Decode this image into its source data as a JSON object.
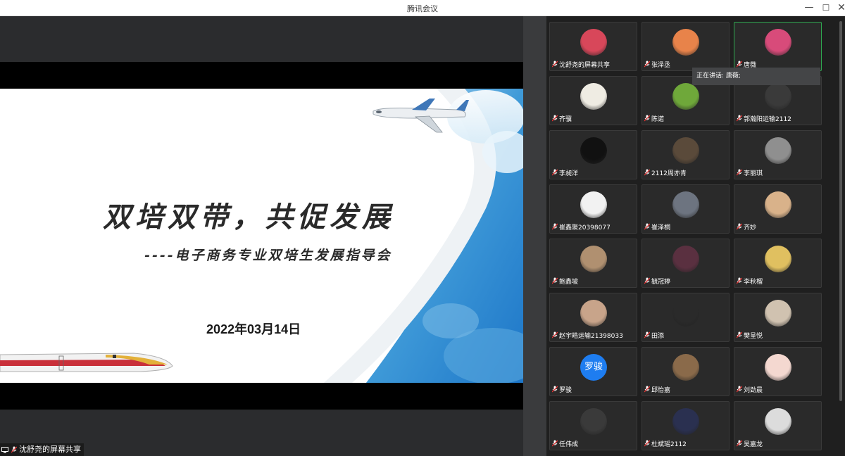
{
  "window": {
    "title": "腾讯会议",
    "min": "—",
    "max": "☐",
    "close": "✕"
  },
  "slide": {
    "title": "双培双带，共促发展",
    "subtitle": "----电子商务专业双培生发展指导会",
    "date": "2022年03月14日"
  },
  "share_label": "沈舒尧的屏幕共享",
  "speaking_tooltip": "正在讲话: 唐薇;",
  "participants": [
    {
      "name": "沈舒尧的屏幕共享",
      "avatar": "city-avatar",
      "color": "#d8475a"
    },
    {
      "name": "张泽丞",
      "avatar": "sunset-avatar",
      "color": "#e8834a"
    },
    {
      "name": "唐薇",
      "avatar": "anime-avatar",
      "color": "#d84b7a"
    },
    {
      "name": "齐骥",
      "avatar": "sketch-avatar",
      "color": "#efece3"
    },
    {
      "name": "陈诺",
      "avatar": "cartoon-avatar",
      "color": "#6fa83a"
    },
    {
      "name": "郭瀚阳运输2112",
      "avatar": "portrait-avatar",
      "color": "#3a3a3a"
    },
    {
      "name": "李昶洋",
      "avatar": "moon-avatar",
      "color": "#111111"
    },
    {
      "name": "2112周亦青",
      "avatar": "guitar-avatar",
      "color": "#5a4a3a"
    },
    {
      "name": "李丽琪",
      "avatar": "cat-avatar",
      "color": "#8f8f8f"
    },
    {
      "name": "崔鑫聚20398077",
      "avatar": "logo-avatar",
      "color": "#f2f2f2"
    },
    {
      "name": "崔泽桐",
      "avatar": "street-avatar",
      "color": "#6d7480"
    },
    {
      "name": "齐妙",
      "avatar": "dog-avatar",
      "color": "#d9b28a"
    },
    {
      "name": "鲍鑫坡",
      "avatar": "kitten-avatar",
      "color": "#b09070"
    },
    {
      "name": "毓冠婷",
      "avatar": "halo-avatar",
      "color": "#5a3040"
    },
    {
      "name": "李秋榴",
      "avatar": "figure-avatar",
      "color": "#e0c060"
    },
    {
      "name": "赵宇皓运输21398033",
      "avatar": "girl-avatar",
      "color": "#c8a48a"
    },
    {
      "name": "田添",
      "avatar": "hat-avatar",
      "color": "#2a2a2a"
    },
    {
      "name": "樊呈悦",
      "avatar": "bucket-hat-avatar",
      "color": "#d0c2b0"
    },
    {
      "name": "罗骏",
      "avatar": "text-avatar",
      "color": "#1e7df0",
      "text": "罗骏"
    },
    {
      "name": "邱怡嘉",
      "avatar": "bear-avatar",
      "color": "#8a6a4a"
    },
    {
      "name": "刘劲晨",
      "avatar": "cat-girl-avatar",
      "color": "#f4d8d0"
    },
    {
      "name": "任伟成",
      "avatar": "singer-avatar",
      "color": "#3a3a3a"
    },
    {
      "name": "杜斌瑶2112",
      "avatar": "night-avatar",
      "color": "#2a3050"
    },
    {
      "name": "吴嘉龙",
      "avatar": "anime-boy-avatar",
      "color": "#dcdcdc"
    }
  ]
}
